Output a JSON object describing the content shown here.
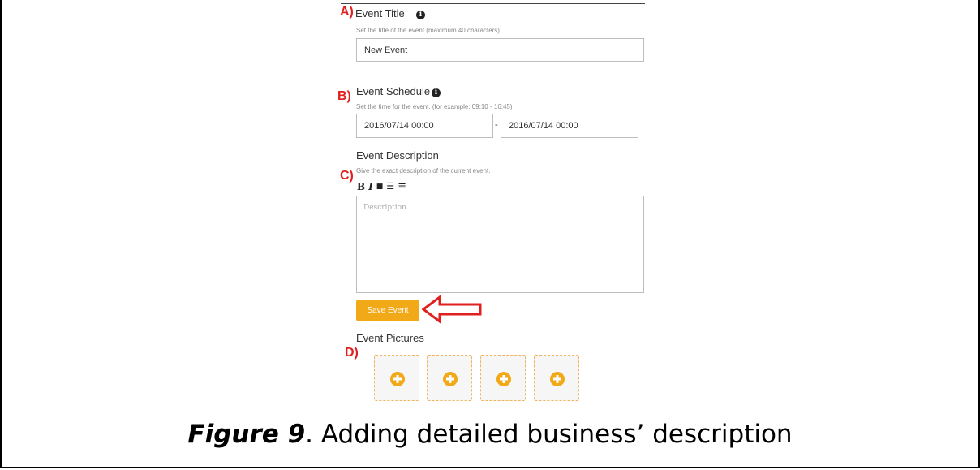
{
  "markers": {
    "a": "A)",
    "b": "B)",
    "c": "C)",
    "d": "D)"
  },
  "title_section": {
    "label": "Event Title",
    "hint": "Set the title of the event (maximum 40 characters).",
    "value": "New Event",
    "info_icon": "i"
  },
  "schedule_section": {
    "label": "Event Schedule",
    "hint": "Set the time for the event. (for example: 09:10 - 16:45)",
    "start_value": "2016/07/14 00:00",
    "separator": "-",
    "end_value": "2016/07/14 00:00",
    "info_icon": "i"
  },
  "description_section": {
    "label": "Event Description",
    "hint": "Give the exact description of the current event.",
    "toolbar": {
      "bold": "B",
      "italic": "I",
      "bookmark": "■",
      "ordered_list": "☰",
      "unordered_list": "≡"
    },
    "placeholder": "Description..."
  },
  "save_button": {
    "label": "Save Event"
  },
  "pictures_section": {
    "label": "Event Pictures",
    "slots": 4
  },
  "caption": {
    "figure": "Figure 9",
    "text": ". Adding detailed business’ description"
  },
  "colors": {
    "accent": "#f2a917",
    "marker": "#e0201e",
    "arrow": "#e0201e"
  }
}
